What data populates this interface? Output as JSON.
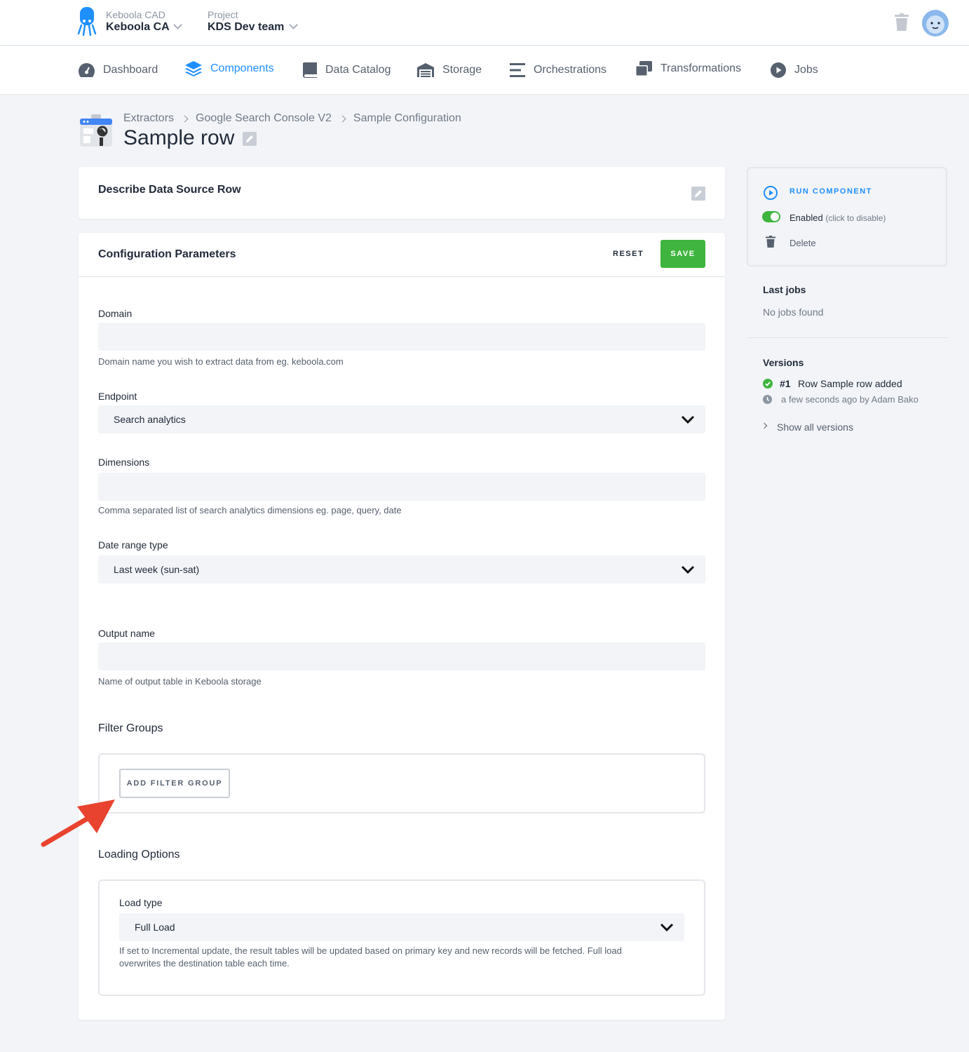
{
  "header": {
    "org_label": "Keboola CAD",
    "org_value": "Keboola CA",
    "project_label": "Project",
    "project_value": "KDS Dev team"
  },
  "nav": {
    "items": [
      {
        "label": "Dashboard",
        "icon": "dashboard-gauge-icon"
      },
      {
        "label": "Components",
        "icon": "layers-icon",
        "active": true
      },
      {
        "label": "Data Catalog",
        "icon": "book-icon"
      },
      {
        "label": "Storage",
        "icon": "warehouse-icon"
      },
      {
        "label": "Orchestrations",
        "icon": "bars-icon"
      },
      {
        "label": "Transformations",
        "icon": "windows-icon"
      },
      {
        "label": "Jobs",
        "icon": "play-circle-icon"
      }
    ]
  },
  "breadcrumb": [
    "Extractors",
    "Google Search Console V2",
    "Sample Configuration"
  ],
  "page_title": "Sample row",
  "describe": {
    "title": "Describe Data Source Row"
  },
  "config": {
    "title": "Configuration Parameters",
    "reset_label": "RESET",
    "save_label": "SAVE",
    "domain": {
      "label": "Domain",
      "value": "",
      "help": "Domain name you wish to extract data from eg. keboola.com"
    },
    "endpoint": {
      "label": "Endpoint",
      "value": "Search analytics"
    },
    "dimensions": {
      "label": "Dimensions",
      "value": "",
      "help": "Comma separated list of search analytics dimensions eg. page, query, date"
    },
    "date_range": {
      "label": "Date range type",
      "value": "Last week (sun-sat)"
    },
    "output": {
      "label": "Output name",
      "value": "",
      "help": "Name of output table in Keboola storage"
    },
    "filter_groups": {
      "title": "Filter Groups",
      "add_label": "ADD FILTER GROUP"
    },
    "loading": {
      "title": "Loading Options",
      "load_type_label": "Load type",
      "load_type_value": "Full Load",
      "help_line1": "If set to Incremental update, the result tables will be updated based on primary key and new records will be fetched. Full load",
      "help_line2": "overwrites the destination table each time."
    }
  },
  "sidebar": {
    "run_label": "RUN COMPONENT",
    "enabled_label": "Enabled",
    "enabled_hint": "(click to disable)",
    "delete_label": "Delete",
    "last_jobs_title": "Last jobs",
    "no_jobs": "No jobs found",
    "versions_title": "Versions",
    "version_number": "#1",
    "version_desc": "Row Sample row added",
    "version_meta": "a few seconds ago by Adam Bako",
    "show_all": "Show all versions"
  },
  "colors": {
    "accent": "#1f8fff",
    "save": "#3fb53f",
    "arrow": "#e8432e"
  }
}
